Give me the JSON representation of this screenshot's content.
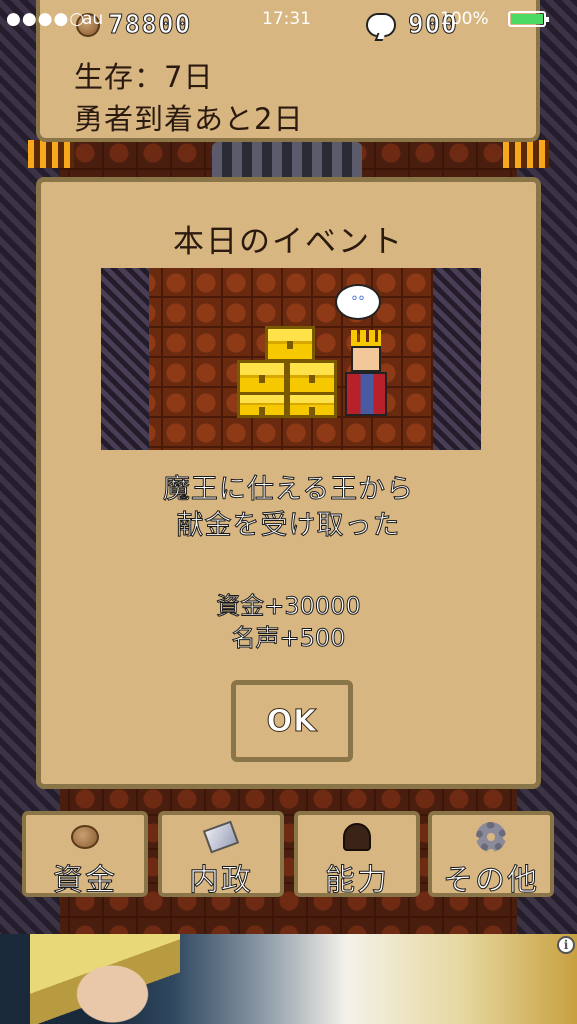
{
  "status_bar": {
    "signal": "●●●●○",
    "carrier": "au",
    "time": "17:31",
    "battery_pct": "100%"
  },
  "stats": {
    "money": "78800",
    "fame": "900",
    "days_alive": "生存：7日",
    "hero_arrival": "勇者到着あと2日"
  },
  "event": {
    "title": "本日のイベント",
    "message_line1": "魔王に仕える王から",
    "message_line2": "献金を受け取った",
    "reward_money": "資金+30000",
    "reward_fame": "名声+500",
    "ok_label": "OK"
  },
  "menu": {
    "items": [
      {
        "label": "資金",
        "icon": "coin-icon"
      },
      {
        "label": "内政",
        "icon": "scroll-icon"
      },
      {
        "label": "能力",
        "icon": "silhouette-icon"
      },
      {
        "label": "その他",
        "icon": "gear-icon"
      }
    ]
  },
  "ad": {
    "info_symbol": "i"
  },
  "colors": {
    "panel_fill": "#d8b681",
    "panel_border": "#8a7548",
    "text_dark": "#2a1a10",
    "battery": "#4cd964",
    "treasure_gold": "#f5c800"
  }
}
